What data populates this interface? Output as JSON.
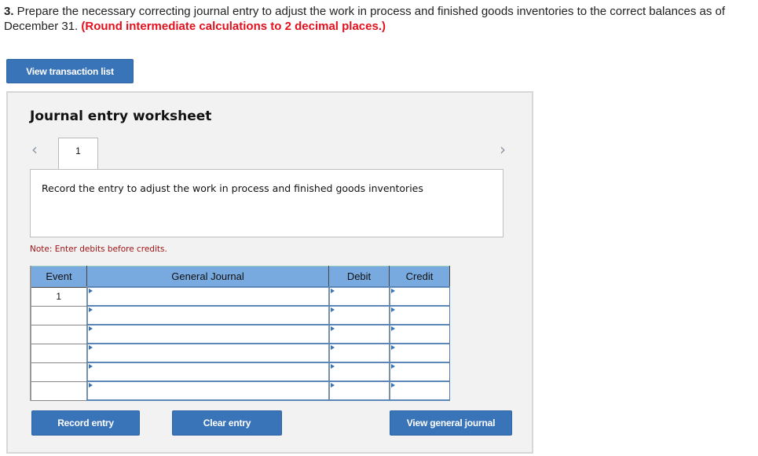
{
  "question": {
    "number": "3.",
    "text": " Prepare the necessary correcting journal entry to adjust the work in process and finished goods inventories to the correct balances as of December 31. ",
    "emphasis": "(Round intermediate calculations to 2 decimal places.)"
  },
  "buttons": {
    "view_transaction_list": "View transaction list",
    "record_entry": "Record entry",
    "clear_entry": "Clear entry",
    "view_general_journal": "View general journal"
  },
  "worksheet": {
    "title": "Journal entry worksheet",
    "prev_icon": "‹",
    "next_icon": "›",
    "current_tab": "1",
    "description": "Record the entry to adjust the work in process and finished goods inventories",
    "note": "Note: Enter debits before credits."
  },
  "table": {
    "headers": [
      "Event",
      "General Journal",
      "Debit",
      "Credit"
    ],
    "rows": [
      {
        "event": "1",
        "account": "",
        "debit": "",
        "credit": ""
      },
      {
        "event": "",
        "account": "",
        "debit": "",
        "credit": ""
      },
      {
        "event": "",
        "account": "",
        "debit": "",
        "credit": ""
      },
      {
        "event": "",
        "account": "",
        "debit": "",
        "credit": ""
      },
      {
        "event": "",
        "account": "",
        "debit": "",
        "credit": ""
      },
      {
        "event": "",
        "account": "",
        "debit": "",
        "credit": ""
      }
    ]
  },
  "colors": {
    "button_blue": "#3a74b8",
    "header_blue": "#78a9df",
    "emphasis_red": "#e3101d",
    "note_red": "#a01414"
  }
}
